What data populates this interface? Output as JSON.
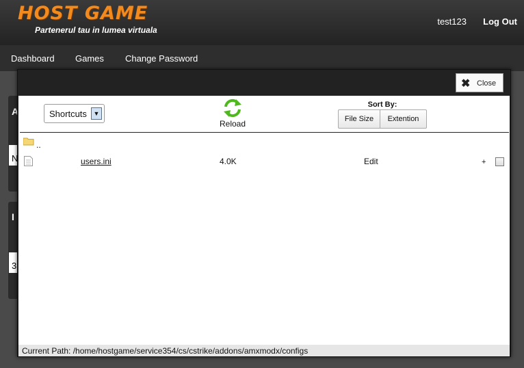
{
  "header": {
    "logo": "HOST GAME",
    "slogan": "Partenerul tau in lumea virtuala",
    "username": "test123",
    "logout": "Log Out"
  },
  "nav": {
    "items": [
      "Dashboard",
      "Games",
      "Change Password"
    ]
  },
  "background": {
    "panel1_title": "A",
    "panel1_cell": "N",
    "panel2_title": "I",
    "panel2_cell": "3"
  },
  "dialog": {
    "close_label": "Close",
    "shortcuts_label": "Shortcuts",
    "reload_label": "Reload",
    "sort_by_label": "Sort By:",
    "sort_options": [
      "File Size",
      "Extention"
    ],
    "parent_dir": "..",
    "files": [
      {
        "name": "users.ini",
        "size": "4.0K",
        "action": "Edit",
        "add": "+"
      }
    ],
    "current_path_label": "Current Path:",
    "current_path": "/home/hostgame/service354/cs/cstrike/addons/amxmodx/configs"
  },
  "colors": {
    "accent": "#f28a1e",
    "reload_green": "#4fb81f"
  },
  "icons": {
    "close": "close-x-icon",
    "reload": "reload-icon",
    "folder": "folder-icon",
    "file": "file-icon",
    "dropdown": "chevron-down-icon"
  }
}
